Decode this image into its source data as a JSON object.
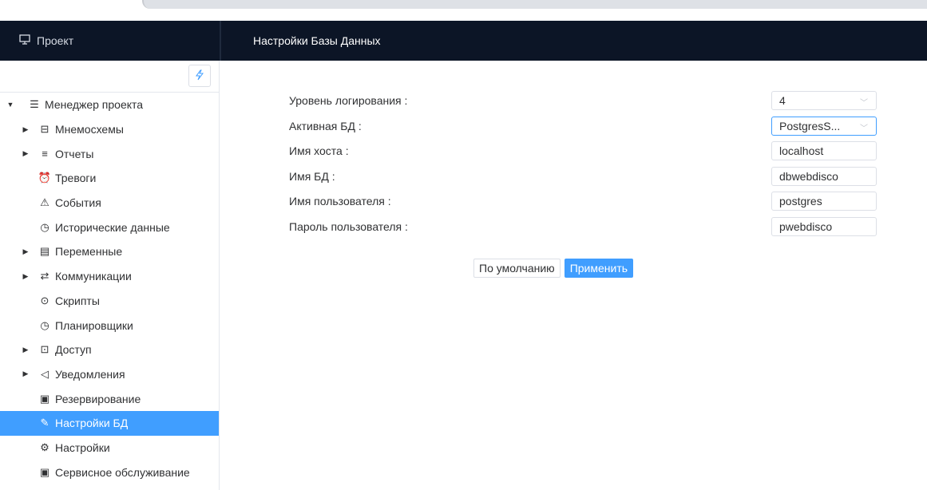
{
  "header": {
    "project_label": "Проект",
    "page_title": "Настройки Базы Данных"
  },
  "sidebar": {
    "root": {
      "label": "Менеджер проекта",
      "icon": "list-icon"
    },
    "items": [
      {
        "label": "Мнемосхемы",
        "icon": "schema-icon",
        "has_arrow": true
      },
      {
        "label": "Отчеты",
        "icon": "report-icon",
        "has_arrow": true
      },
      {
        "label": "Тревоги",
        "icon": "alarm-icon",
        "has_arrow": false
      },
      {
        "label": "События",
        "icon": "warning-icon",
        "has_arrow": false
      },
      {
        "label": "Исторические данные",
        "icon": "clock-icon",
        "has_arrow": false
      },
      {
        "label": "Переменные",
        "icon": "variables-icon",
        "has_arrow": true
      },
      {
        "label": "Коммуникации",
        "icon": "connection-icon",
        "has_arrow": true
      },
      {
        "label": "Скрипты",
        "icon": "script-icon",
        "has_arrow": false
      },
      {
        "label": "Планировщики",
        "icon": "scheduler-icon",
        "has_arrow": false
      },
      {
        "label": "Доступ",
        "icon": "lock-icon",
        "has_arrow": true
      },
      {
        "label": "Уведомления",
        "icon": "notification-icon",
        "has_arrow": true
      },
      {
        "label": "Резервирование",
        "icon": "backup-icon",
        "has_arrow": false
      },
      {
        "label": "Настройки БД",
        "icon": "wrench-icon",
        "has_arrow": false,
        "active": true
      },
      {
        "label": "Настройки",
        "icon": "gear-icon",
        "has_arrow": false
      },
      {
        "label": "Сервисное обслуживание",
        "icon": "service-icon",
        "has_arrow": false
      }
    ]
  },
  "form": {
    "log_level": {
      "label": "Уровень логирования",
      "value": "4"
    },
    "active_db": {
      "label": "Активная БД",
      "value": "PostgresS..."
    },
    "host": {
      "label": "Имя хоста",
      "value": "localhost"
    },
    "db_name": {
      "label": "Имя БД",
      "value": "dbwebdisco"
    },
    "user": {
      "label": "Имя пользователя",
      "value": "postgres"
    },
    "password": {
      "label": "Пароль пользователя",
      "value": "pwebdisco"
    }
  },
  "buttons": {
    "default_label": "По умолчанию",
    "apply_label": "Применить"
  },
  "colors": {
    "header_bg": "#0c1526",
    "accent": "#409eff"
  }
}
